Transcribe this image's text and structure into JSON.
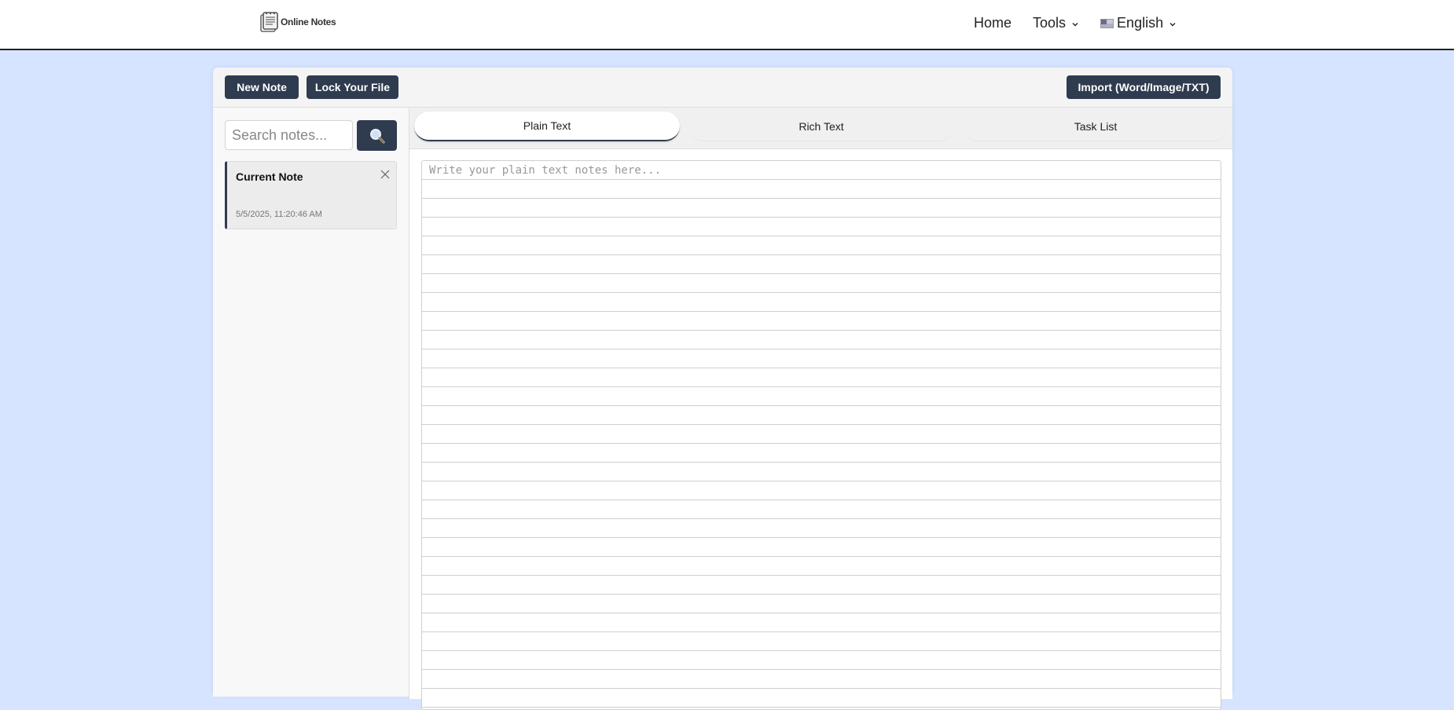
{
  "header": {
    "logo_text": "Online Notes",
    "nav": {
      "home": "Home",
      "tools": "Tools",
      "language": "English"
    }
  },
  "toolbar": {
    "new_note": "New Note",
    "lock_file": "Lock Your File",
    "import": "Import (Word/Image/TXT)"
  },
  "sidebar": {
    "search_placeholder": "Search notes...",
    "notes": [
      {
        "title": "Current Note",
        "date": "5/5/2025, 11:20:46 AM"
      }
    ]
  },
  "tabs": [
    {
      "label": "Plain Text",
      "active": true
    },
    {
      "label": "Rich Text",
      "active": false
    },
    {
      "label": "Task List",
      "active": false
    }
  ],
  "editor": {
    "placeholder": "Write your plain text notes here..."
  },
  "colors": {
    "background": "#d6e4ff",
    "button": "#2f3b4f"
  }
}
